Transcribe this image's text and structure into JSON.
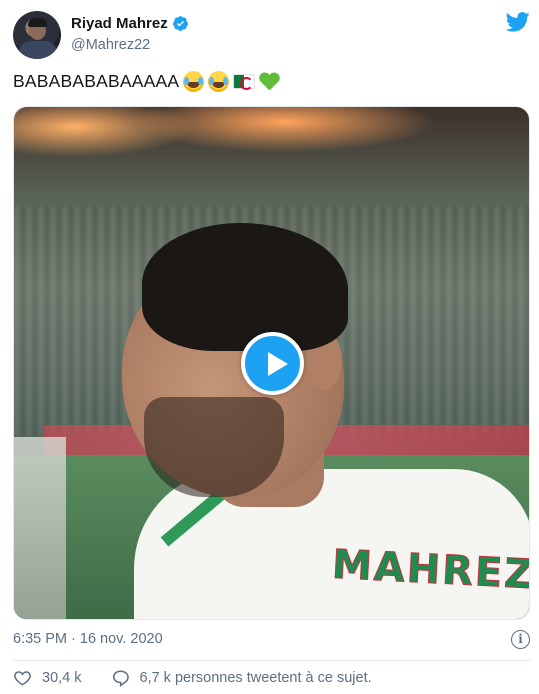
{
  "header": {
    "display_name": "Riyad Mahrez",
    "handle": "@Mahrez22",
    "avatar_icon": "user-avatar",
    "verified_icon": "verified-badge-icon",
    "brand_icon": "twitter-bird-icon",
    "brand_color": "#1da1f2"
  },
  "tweet": {
    "text": "BABABABABAAAAA",
    "emojis": [
      "laughing-tears-emoji",
      "laughing-tears-emoji",
      "algeria-flag-emoji",
      "green-heart-emoji"
    ]
  },
  "media": {
    "type": "video",
    "play_icon": "play-icon",
    "jersey_text": "MAHREZ"
  },
  "footer": {
    "timestamp": "6:35 PM · 16 nov. 2020",
    "info_icon": "info-icon",
    "likes": "30,4 k",
    "conversation": "6,7 k personnes tweetent à ce sujet."
  },
  "colors": {
    "text_primary": "#14171a",
    "text_secondary": "#5b7083",
    "divider": "#e1e8ed"
  }
}
